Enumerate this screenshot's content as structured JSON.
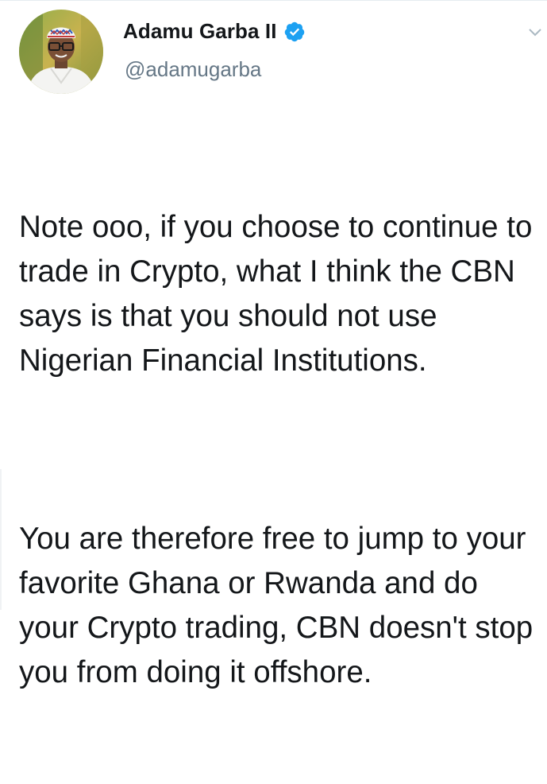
{
  "tweet": {
    "author": {
      "display_name": "Adamu Garba II",
      "handle": "@adamugarba",
      "verified": true,
      "avatar_icon": "profile-photo"
    },
    "paragraphs": [
      "Note ooo, if you choose to continue to trade in Crypto, what I think the CBN says is that you should not use Nigerian Financial Institutions.",
      "You are therefore free to jump to your favorite Ghana or Rwanda and do your Crypto trading, CBN doesn't stop you from doing it offshore."
    ],
    "menu_icon": "chevron-down-icon"
  },
  "colors": {
    "text_primary": "#14171a",
    "text_secondary": "#657786",
    "verified_badge": "#1da1f2",
    "divider": "#e6ecf0"
  }
}
